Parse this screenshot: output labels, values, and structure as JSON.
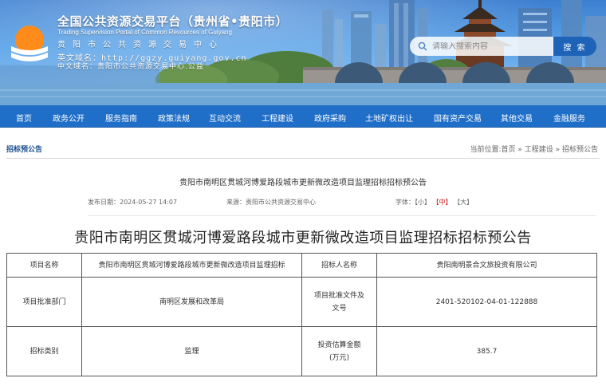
{
  "header": {
    "title": "全国公共资源交易平台（贵州省•贵阳市）",
    "title_en": "Trading Supervision Portal of Common Resources of Guiyang",
    "subtitle": "贵阳市公共资源交易中心",
    "domain_en": "英文域名：http://ggzy.guiyang.gov.cn",
    "domain_cn": "中文域名：贵阳市公共资源交易中心.公益"
  },
  "search": {
    "placeholder": "请输入搜索内容",
    "button_label": "搜 索"
  },
  "nav": {
    "items": [
      "首页",
      "政务公开",
      "服务指南",
      "政策法规",
      "互动交流",
      "工程建设",
      "政府采购",
      "土地矿权出让",
      "国有资产交易",
      "其他交易",
      "金融服务"
    ]
  },
  "section": {
    "label": "招标预公告",
    "breadcrumb": "当前位置:首页 » 工程建设 » 招标预公告"
  },
  "article": {
    "small_title": "贵阳市南明区贯城河博爱路段城市更新微改造项目监理招标招标预公告",
    "publish_label": "发布日期：",
    "publish_date": "2024-05-27 14:07",
    "source_label": "来源：",
    "source": "贵阳市公共资源交易中心",
    "font_label": "字体：",
    "font_small": "【小】",
    "font_medium": "【中】",
    "font_large": "【大】",
    "big_title": "贵阳市南明区贯城河博爱路段城市更新微改造项目监理招标招标预公告"
  },
  "table": {
    "rows": [
      [
        "项目名称",
        "贵阳市南明区贯城河博爱路段城市更新微改造项目监理招标",
        "招标人名称",
        "贵阳南明景合文旅投资有限公司"
      ],
      [
        "项目批准部门",
        "南明区发展和改革局",
        "项目批准文件及文号",
        "2401-520102-04-01-122888"
      ],
      [
        "招标类别",
        "监理",
        "投资估算金额(万元)",
        "385.7"
      ]
    ]
  },
  "colors": {
    "nav_bg": "#1f6ec7",
    "search_button": "#1e63b8",
    "highlight_red": "#d01a1a",
    "section_label": "#1a4e8c"
  }
}
